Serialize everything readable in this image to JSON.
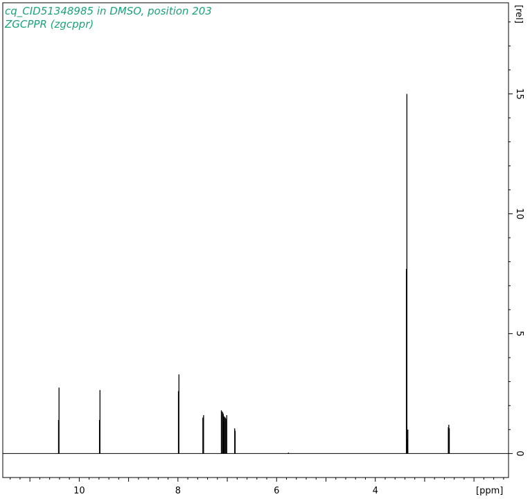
{
  "header": {
    "title": "cq_CID51348985 in DMSO, position 203",
    "subtitle": "ZGCPPR (zgcppr)",
    "title_color": "#1aa37a"
  },
  "chart_data": {
    "type": "line",
    "title": "cq_CID51348985 in DMSO, position 203",
    "subtitle": "ZGCPPR (zgcppr)",
    "xlabel": "[ppm]",
    "ylabel": "[rel]",
    "x_reversed": true,
    "xlim": [
      11.55,
      1.3
    ],
    "ylim": [
      -1.0,
      18.8
    ],
    "x_ticks": [
      10,
      8,
      6,
      4
    ],
    "y_ticks": [
      0,
      5,
      10,
      15
    ],
    "grid": false,
    "line_color": "#000000",
    "series": [
      {
        "peaks": [
          {
            "ppm": 10.41,
            "height": 2.75
          },
          {
            "ppm": 10.42,
            "height": 1.4
          },
          {
            "ppm": 9.58,
            "height": 2.65
          },
          {
            "ppm": 9.59,
            "height": 1.4
          },
          {
            "ppm": 7.98,
            "height": 3.3
          },
          {
            "ppm": 7.99,
            "height": 2.6
          },
          {
            "ppm": 7.48,
            "height": 1.6
          },
          {
            "ppm": 7.495,
            "height": 1.5
          },
          {
            "ppm": 7.12,
            "height": 1.8
          },
          {
            "ppm": 7.1,
            "height": 1.75
          },
          {
            "ppm": 7.09,
            "height": 1.7
          },
          {
            "ppm": 7.08,
            "height": 1.65
          },
          {
            "ppm": 7.07,
            "height": 1.5
          },
          {
            "ppm": 7.06,
            "height": 1.55
          },
          {
            "ppm": 7.04,
            "height": 1.5
          },
          {
            "ppm": 7.03,
            "height": 1.45
          },
          {
            "ppm": 7.01,
            "height": 1.6
          },
          {
            "ppm": 6.85,
            "height": 1.05
          },
          {
            "ppm": 6.84,
            "height": 0.95
          },
          {
            "ppm": 5.76,
            "height": 0.04
          },
          {
            "ppm": 3.36,
            "height": 15.0
          },
          {
            "ppm": 3.37,
            "height": 7.7
          },
          {
            "ppm": 3.34,
            "height": 1.0
          },
          {
            "ppm": 3.35,
            "height": 0.6
          },
          {
            "ppm": 2.51,
            "height": 1.2
          },
          {
            "ppm": 2.52,
            "height": 1.1
          },
          {
            "ppm": 2.5,
            "height": 1.05
          }
        ]
      }
    ]
  }
}
